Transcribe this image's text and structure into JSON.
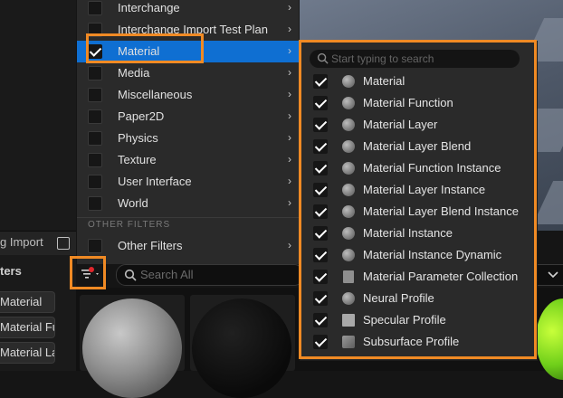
{
  "left_panel": {
    "import_label": "g Import",
    "filters_heading": "ters",
    "filter_chips": [
      "Material",
      "Material Fu",
      "Material La"
    ]
  },
  "bottom_search": {
    "placeholder": "Search All"
  },
  "menu": {
    "rows": [
      {
        "label": "Interchange",
        "checked": false,
        "arrow": "›"
      },
      {
        "label": "Interchange Import Test Plan",
        "checked": false,
        "arrow": "›"
      },
      {
        "label": "Material",
        "checked": true,
        "arrow": "›",
        "selected": true
      },
      {
        "label": "Media",
        "checked": false,
        "arrow": "›"
      },
      {
        "label": "Miscellaneous",
        "checked": false,
        "arrow": "›"
      },
      {
        "label": "Paper2D",
        "checked": false,
        "arrow": "›"
      },
      {
        "label": "Physics",
        "checked": false,
        "arrow": "›"
      },
      {
        "label": "Texture",
        "checked": false,
        "arrow": "›"
      },
      {
        "label": "User Interface",
        "checked": false,
        "arrow": "›"
      },
      {
        "label": "World",
        "checked": false,
        "arrow": "›"
      }
    ],
    "other_filters_heading": "OTHER FILTERS",
    "other_filters_row": {
      "label": "Other Filters",
      "checked": false,
      "arrow": "›"
    }
  },
  "submenu": {
    "search_placeholder": "Start typing to search",
    "items": [
      {
        "label": "Material",
        "checked": true,
        "icon": "material-sphere-icon"
      },
      {
        "label": "Material Function",
        "checked": true,
        "icon": "material-function-icon"
      },
      {
        "label": "Material Layer",
        "checked": true,
        "icon": "material-layer-icon"
      },
      {
        "label": "Material Layer Blend",
        "checked": true,
        "icon": "material-layer-blend-icon"
      },
      {
        "label": "Material Function Instance",
        "checked": true,
        "icon": "material-instance-icon"
      },
      {
        "label": "Material Layer Instance",
        "checked": true,
        "icon": "material-instance-icon"
      },
      {
        "label": "Material Layer Blend Instance",
        "checked": true,
        "icon": "material-instance-icon"
      },
      {
        "label": "Material Instance",
        "checked": true,
        "icon": "material-instance-icon"
      },
      {
        "label": "Material Instance Dynamic",
        "checked": true,
        "icon": "material-instance-icon"
      },
      {
        "label": "Material Parameter Collection",
        "checked": true,
        "icon": "parameter-collection-icon"
      },
      {
        "label": "Neural Profile",
        "checked": true,
        "icon": "neural-profile-icon"
      },
      {
        "label": "Specular Profile",
        "checked": true,
        "icon": "specular-profile-icon"
      },
      {
        "label": "Subsurface Profile",
        "checked": true,
        "icon": "subsurface-profile-icon"
      }
    ]
  },
  "colors": {
    "selection": "#0f6fd2",
    "highlight": "#f08a24",
    "menu_bg": "#2a2a2a"
  }
}
